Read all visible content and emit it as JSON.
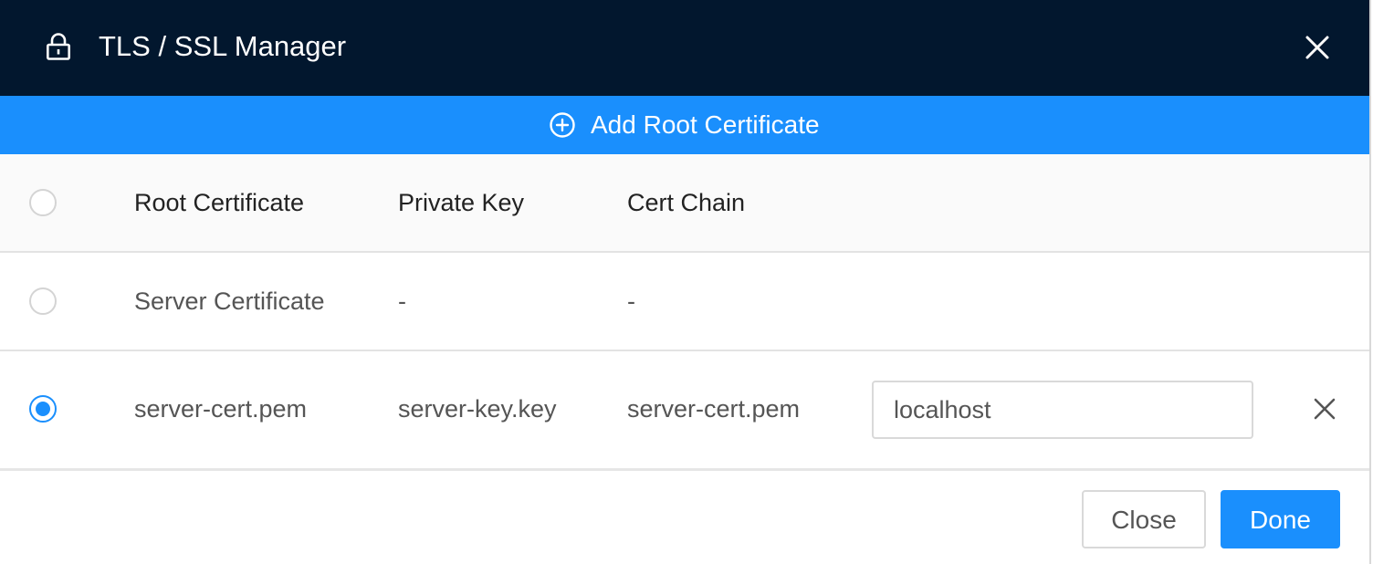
{
  "dialog": {
    "title": "TLS / SSL Manager",
    "title_icon": "lock-icon",
    "close_icon": "close-icon"
  },
  "add_bar": {
    "label": "Add Root Certificate",
    "icon": "plus-circle-icon",
    "color": "#1a8ffd"
  },
  "table": {
    "headers": [
      "Root Certificate",
      "Private Key",
      "Cert Chain"
    ],
    "rows": [
      {
        "selected": false,
        "root_certificate": "Server Certificate",
        "private_key": "-",
        "cert_chain": "-"
      },
      {
        "selected": true,
        "root_certificate": "server-cert.pem",
        "private_key": "server-key.key",
        "cert_chain": "server-cert.pem",
        "host_value": "localhost",
        "remove_icon": "close-icon"
      }
    ]
  },
  "footer": {
    "close_label": "Close",
    "done_label": "Done"
  },
  "colors": {
    "titlebar": "#02172e",
    "accent": "#1a8ffd"
  }
}
